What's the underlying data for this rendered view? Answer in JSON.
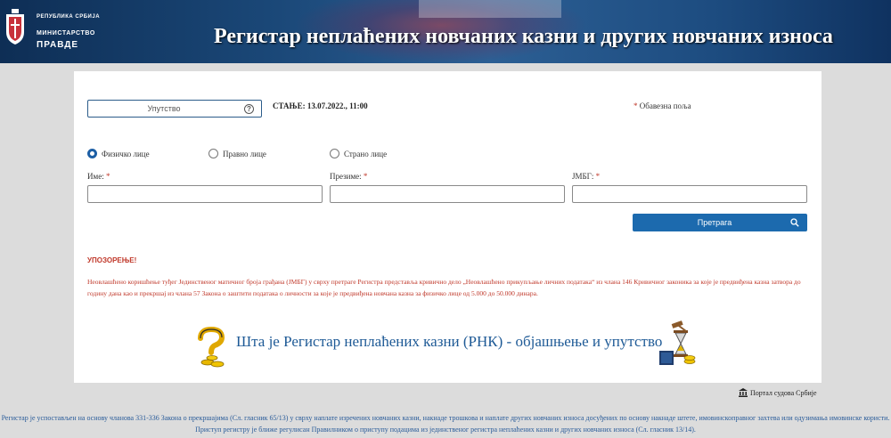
{
  "header": {
    "republic": "РЕПУБЛИКА СРБИЈА",
    "ministry": "МИНИСТАРСТВО",
    "justice": "ПРАВДЕ",
    "title": "Регистар неплаћених новчаних казни и других новчаних износа"
  },
  "top": {
    "help_label": "Упутство",
    "help_icon": "?",
    "state": "СТАЊЕ: 13.07.2022., 11:00",
    "required_star": "*",
    "required_label": "Обавезна поља"
  },
  "radios": [
    {
      "label": "Физичко лице",
      "selected": true
    },
    {
      "label": "Правно лице",
      "selected": false
    },
    {
      "label": "Страно лице",
      "selected": false
    }
  ],
  "fields": {
    "first_name": {
      "label": "Име:",
      "star": "*",
      "value": ""
    },
    "last_name": {
      "label": "Презиме:",
      "star": "*",
      "value": ""
    },
    "jmbg": {
      "label": "ЈМБГ:",
      "star": "*",
      "value": ""
    }
  },
  "search_button": "Претрага",
  "warning": {
    "title": "УПОЗОРЕЊЕ!",
    "text": "Неовлашћено коришћење туђег Јединственог матичног броја грађана (ЈМБГ) у сврху претраге Регистра представља кривично дело „Неовлашћено прикупљање личних података“ из члана 146 Кривичног законика за које је предвиђена казна затвора до годину дана као и прекршај из члана 57 Закона о заштити података о личности за које је предвиђена новчана казна за физичко лице од 5.000 до 50.000 динара."
  },
  "promo_text": "Шта је Регистар неплаћених казни (РНК) - објашњење и упутство",
  "portal_link": "Портал судова Србије",
  "footer_text": "Регистар је успостављен на основу чланова 331-336 Закона о прекршајима (Сл. гласник 65/13) у сврху наплате изречених новчаних казни, накнаде трошкова и наплате других новчаних износа досуђених по основу накнаде штете, имовинскоправног захтева или одузимања имовинске користи. Приступ регистру је ближе регулисан Правилником о приступу подацима из јединственог регистра неплаћених казни и других новчаних износа (Сл. гласник 13/14).",
  "colors": {
    "header_blue": "#1a4777",
    "button_blue": "#1c6aae",
    "warning_red": "#c0392b",
    "link_blue": "#1e5a96"
  }
}
